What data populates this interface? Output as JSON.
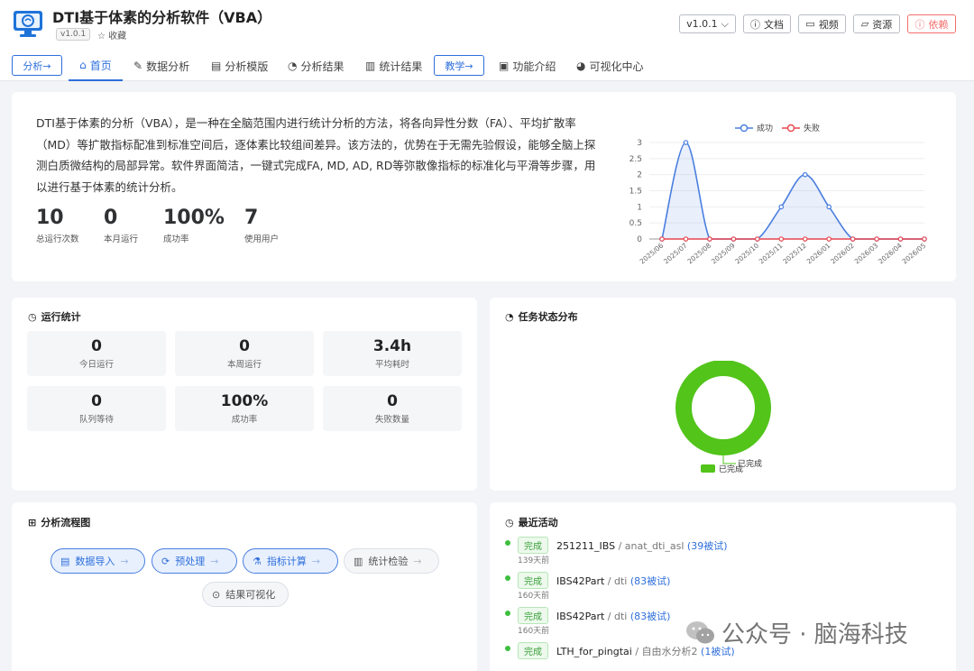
{
  "app": {
    "title": "DTI基于体素的分析软件（VBA）",
    "version": "v1.0.1",
    "favorite": "收藏"
  },
  "header_actions": {
    "version_select": "v1.0.1",
    "docs": "文档",
    "video": "视频",
    "resources": "资源",
    "dependencies": "依赖"
  },
  "nav": {
    "analysis_btn": "分析→",
    "items": [
      "首页",
      "数据分析",
      "分析模版",
      "分析结果",
      "统计结果"
    ],
    "teach_btn": "教学→",
    "items2": [
      "功能介绍",
      "可视化中心"
    ]
  },
  "intro": {
    "text": "DTI基于体素的分析（VBA），是一种在全脑范围内进行统计分析的方法，将各向异性分数（FA）、平均扩散率（MD）等扩散指标配准到标准空间后，逐体素比较组间差异。该方法的，优势在于无需先验假设，能够全脑上探测白质微结构的局部异常。软件界面简洁，一键式完成FA, MD, AD, RD等弥散像指标的标准化与平滑等步骤，用以进行基于体素的统计分析。",
    "kpis": [
      {
        "value": "10",
        "label": "总运行次数",
        "color": "#2f6fdb"
      },
      {
        "value": "0",
        "label": "本月运行",
        "color": "#52c41a"
      },
      {
        "value": "100%",
        "label": "成功率",
        "color": "#52c41a"
      },
      {
        "value": "7",
        "label": "使用用户",
        "color": "#444444"
      }
    ]
  },
  "chart_data": {
    "type": "line",
    "categories": [
      "2025/06",
      "2025/07",
      "2025/08",
      "2025/09",
      "2025/10",
      "2025/11",
      "2025/12",
      "2026/01",
      "2026/02",
      "2026/03",
      "2026/04",
      "2026/05"
    ],
    "series": [
      {
        "name": "成功",
        "values": [
          0,
          3,
          0,
          0,
          0,
          1,
          2,
          1,
          0,
          0,
          0,
          0
        ],
        "color": "#4a7fe0"
      },
      {
        "name": "失败",
        "values": [
          0,
          0,
          0,
          0,
          0,
          0,
          0,
          0,
          0,
          0,
          0,
          0
        ],
        "color": "#e8474f"
      }
    ],
    "ylim": [
      0,
      3
    ],
    "yticks": [
      "0",
      "0.5",
      "1",
      "1.5",
      "2",
      "2.5",
      "3"
    ],
    "legend": "top"
  },
  "run_stats": {
    "title": "运行统计",
    "items": [
      {
        "value": "0",
        "label": "今日运行"
      },
      {
        "value": "0",
        "label": "本周运行"
      },
      {
        "value": "3.4h",
        "label": "平均耗时"
      },
      {
        "value": "0",
        "label": "队列等待"
      },
      {
        "value": "100%",
        "label": "成功率"
      },
      {
        "value": "0",
        "label": "失败数量"
      }
    ]
  },
  "task_status": {
    "title": "任务状态分布",
    "legend_label": "已完成",
    "slice_label": "已完成",
    "slices": [
      {
        "name": "已完成",
        "value": 1.0,
        "color": "#52c41a"
      }
    ]
  },
  "flow": {
    "title": "分析流程图",
    "steps": [
      {
        "label": "数据导入",
        "arrow": "→"
      },
      {
        "label": "预处理",
        "arrow": "→"
      },
      {
        "label": "指标计算",
        "arrow": "→"
      },
      {
        "label": "统计检验",
        "arrow": "→"
      },
      {
        "label": "结果可视化",
        "arrow": ""
      }
    ]
  },
  "activity": {
    "title": "最近活动",
    "items": [
      {
        "status": "完成",
        "name": "251211_IBS",
        "path": " / anat_dti_asl",
        "count": " (39被试)",
        "time": "139天前"
      },
      {
        "status": "完成",
        "name": "IBS42Part",
        "path": " / dti",
        "count": " (83被试)",
        "time": "160天前"
      },
      {
        "status": "完成",
        "name": "IBS42Part",
        "path": " / dti",
        "count": " (83被试)",
        "time": "160天前"
      },
      {
        "status": "完成",
        "name": "LTH_for_pingtai",
        "path": " / 自由水分析2",
        "count": " (1被试)",
        "time": ""
      }
    ]
  },
  "watermark": "公众号 · 脑海科技"
}
